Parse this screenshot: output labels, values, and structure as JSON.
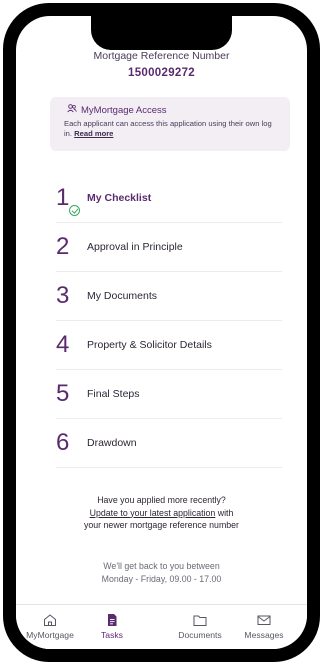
{
  "header": {
    "ref_label": "Mortgage Reference Number",
    "ref_number": "1500029272"
  },
  "access_card": {
    "icon": "users-icon",
    "title": "MyMortgage Access",
    "body": "Each applicant can access this application using their own log in.",
    "link": "Read more"
  },
  "steps": [
    {
      "number": "1",
      "label": "My Checklist",
      "active": true,
      "completed": true
    },
    {
      "number": "2",
      "label": "Approval in Principle"
    },
    {
      "number": "3",
      "label": "My Documents"
    },
    {
      "number": "4",
      "label": "Property & Solicitor Details"
    },
    {
      "number": "5",
      "label": "Final Steps"
    },
    {
      "number": "6",
      "label": "Drawdown"
    }
  ],
  "recent": {
    "question": "Have you applied more recently?",
    "link": "Update to your latest application",
    "link_suffix": " with",
    "line3": "your newer mortgage reference number"
  },
  "hours": {
    "line1": "We'll get back to you between",
    "line2": "Monday - Friday, 09.00 - 17.00"
  },
  "tabs": [
    {
      "label": "MyMortgage",
      "icon": "home-icon"
    },
    {
      "label": "Tasks",
      "icon": "document-icon",
      "active": true
    },
    {
      "label": "Documents",
      "icon": "folder-icon"
    },
    {
      "label": "Messages",
      "icon": "mail-icon"
    }
  ],
  "colors": {
    "brand": "#5a2a6e",
    "success": "#3aa55f",
    "card_bg": "#f2eef4"
  }
}
